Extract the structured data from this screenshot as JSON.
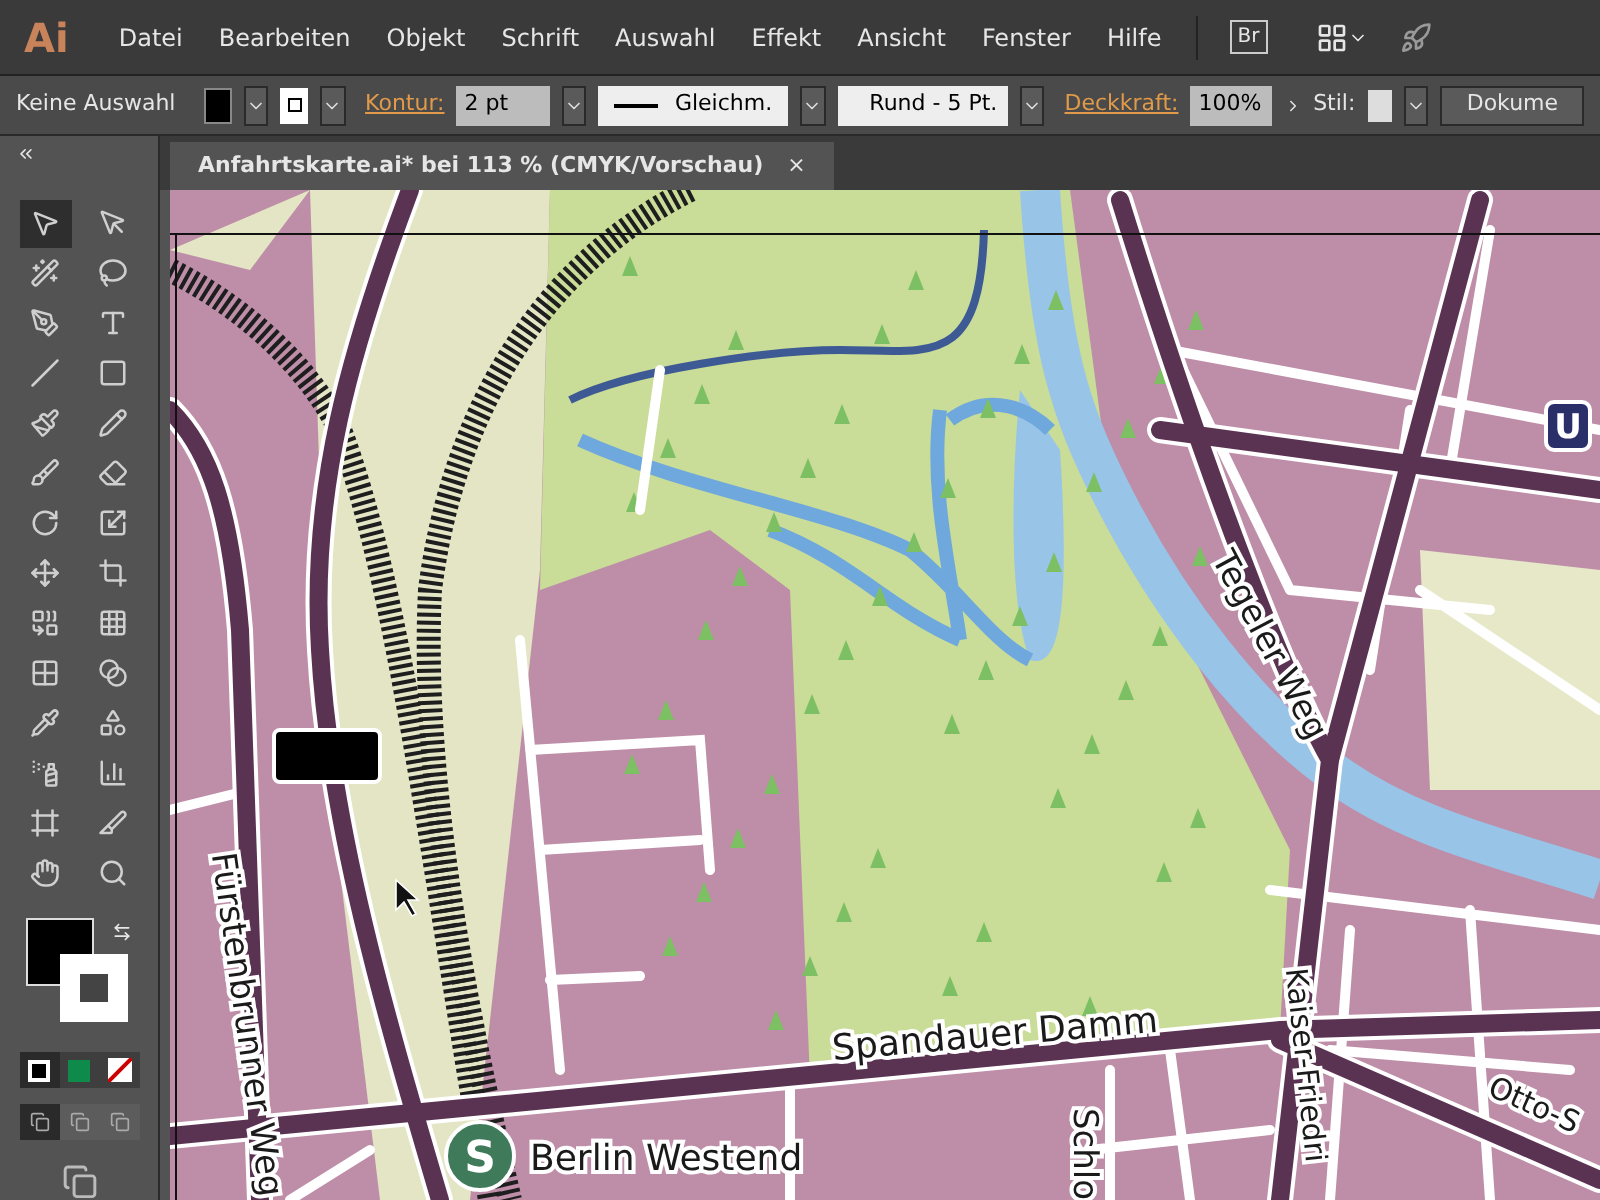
{
  "menu_bar": {
    "logo": "Ai",
    "items": [
      "Datei",
      "Bearbeiten",
      "Objekt",
      "Schrift",
      "Auswahl",
      "Effekt",
      "Ansicht",
      "Fenster",
      "Hilfe"
    ],
    "bridge_button": "Br"
  },
  "control_bar": {
    "selection": "Keine Auswahl",
    "stroke_label": "Kontur:",
    "stroke_weight": "2 pt",
    "profile": "Gleichm.",
    "brush": "Rund - 5 Pt.",
    "opacity_label": "Deckkraft:",
    "opacity": "100%",
    "style_label": "Stil:",
    "document_button": "Dokume"
  },
  "document_tab": {
    "title": "Anfahrtskarte.ai* bei 113 % (CMYK/Vorschau)",
    "close": "×"
  },
  "tools": [
    {
      "kind": "selection",
      "selected": true
    },
    {
      "kind": "direct",
      "selected": false
    },
    {
      "kind": "wand",
      "selected": false
    },
    {
      "kind": "lasso",
      "selected": false
    },
    {
      "kind": "pen",
      "selected": false
    },
    {
      "kind": "type",
      "selected": false
    },
    {
      "kind": "line",
      "selected": false
    },
    {
      "kind": "rectangle",
      "selected": false
    },
    {
      "kind": "brush",
      "selected": false
    },
    {
      "kind": "pencil",
      "selected": false
    },
    {
      "kind": "blob",
      "selected": false
    },
    {
      "kind": "eraser",
      "selected": false
    },
    {
      "kind": "rotate",
      "selected": false
    },
    {
      "kind": "scale",
      "selected": false
    },
    {
      "kind": "puppet",
      "selected": false
    },
    {
      "kind": "transform",
      "selected": false
    },
    {
      "kind": "builder",
      "selected": false
    },
    {
      "kind": "perspective",
      "selected": false
    },
    {
      "kind": "mesh",
      "selected": false
    },
    {
      "kind": "gradient",
      "selected": false
    },
    {
      "kind": "eyedropper",
      "selected": false
    },
    {
      "kind": "blend",
      "selected": false
    },
    {
      "kind": "spray",
      "selected": false
    },
    {
      "kind": "graph",
      "selected": false
    },
    {
      "kind": "artboard",
      "selected": false
    },
    {
      "kind": "slice",
      "selected": false
    },
    {
      "kind": "hand",
      "selected": false
    },
    {
      "kind": "zoom",
      "selected": false
    }
  ],
  "color_modes": [
    {
      "kind": "color",
      "selected": true
    },
    {
      "kind": "gradient",
      "selected": false
    },
    {
      "kind": "none",
      "selected": false
    }
  ],
  "draw_modes": [
    {
      "selected": true
    },
    {
      "selected": false
    },
    {
      "selected": false
    }
  ],
  "map": {
    "labels": [
      {
        "text": "Fürstenbrunner Weg",
        "kind": "street"
      },
      {
        "text": "Tegeler Weg",
        "kind": "street"
      },
      {
        "text": "Spandauer Damm",
        "kind": "street"
      },
      {
        "text": "Schlo",
        "kind": "street"
      },
      {
        "text": "Kaiser-Friedri",
        "kind": "street"
      },
      {
        "text": "Otto-S",
        "kind": "street"
      }
    ],
    "station": {
      "badge": "S",
      "name": "Berlin Westend"
    },
    "metro_badge": "U"
  }
}
